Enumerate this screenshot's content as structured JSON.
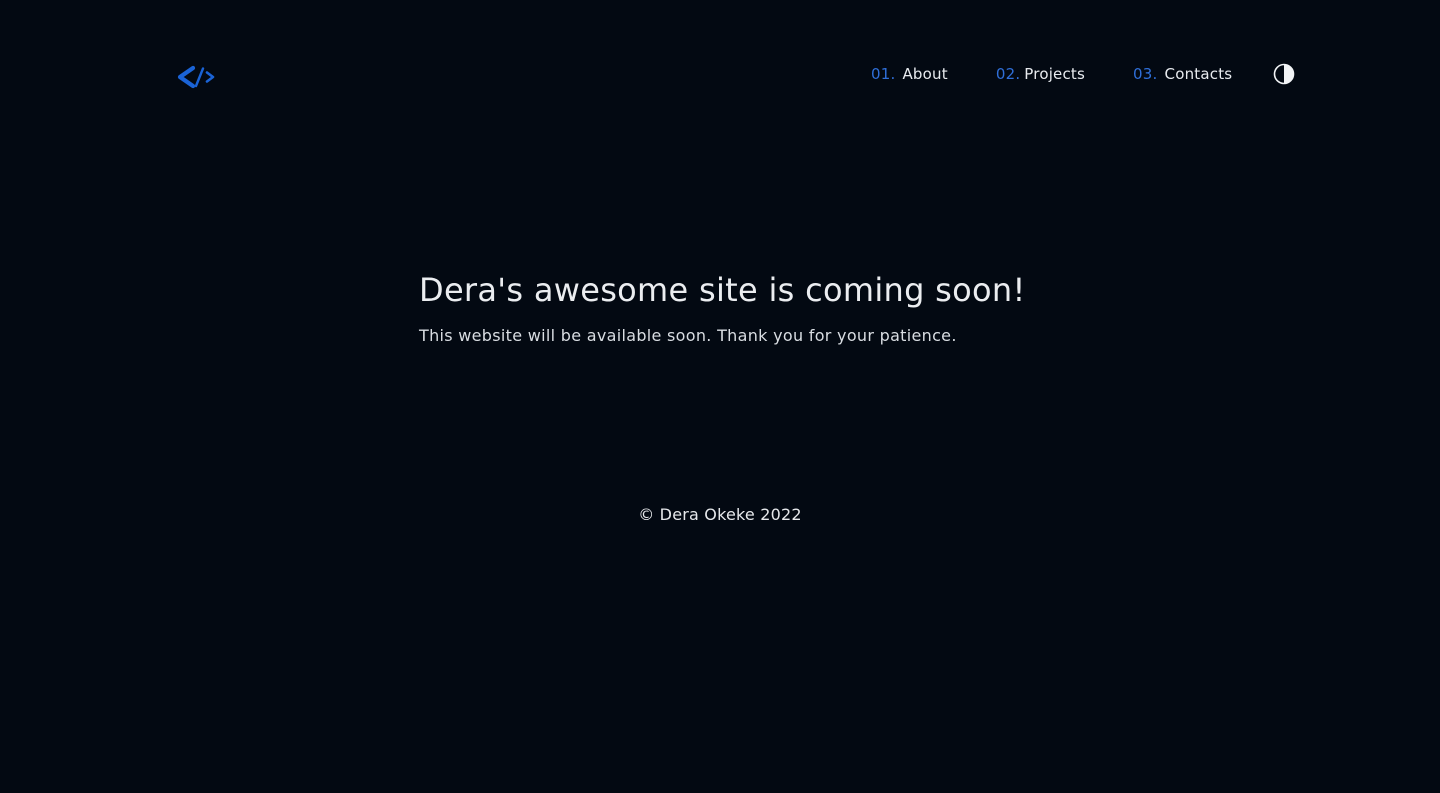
{
  "header": {
    "logo_icon": "code-brackets-icon",
    "nav": [
      {
        "number": "01.",
        "label": "About"
      },
      {
        "number": "02.",
        "label": "Projects"
      },
      {
        "number": "03.",
        "label": "Contacts"
      }
    ],
    "theme_toggle_icon": "contrast-half-circle-icon"
  },
  "hero": {
    "title": "Dera's awesome site is coming soon!",
    "subtitle": "This website will be available soon. Thank you for your patience."
  },
  "footer": {
    "copyright": "© Dera Okeke 2022"
  },
  "colors": {
    "background": "#030912",
    "accent": "#2f6fd9",
    "text": "#e8ebef"
  }
}
